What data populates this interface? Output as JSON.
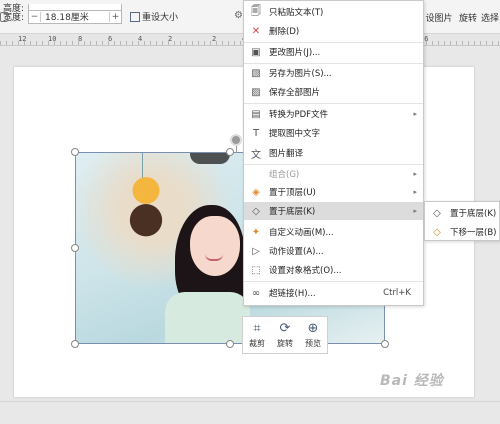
{
  "ribbon": {
    "height_label": "高度:",
    "width_label": "宽度:",
    "width_value": "18.18厘米",
    "minus": "−",
    "plus": "+",
    "reset_size": "重设大小",
    "set_picture": "设图片",
    "rotate": "旋转",
    "select": "选择"
  },
  "ruler": {
    "numbers": [
      "12",
      "10",
      "8",
      "6",
      "4",
      "2",
      "2",
      "4",
      "6",
      "8",
      "10",
      "12",
      "14",
      "16"
    ]
  },
  "context_menu": {
    "items": [
      {
        "icon": "paste-text-icon",
        "glyph": "🗐",
        "label": "只粘贴文本(T)"
      },
      {
        "icon": "delete-icon",
        "glyph": "✕",
        "label": "删除(D)"
      },
      {
        "icon": "change-picture-icon",
        "glyph": "▣",
        "label": "更改图片(J)..."
      },
      {
        "icon": "save-as-picture-icon",
        "glyph": "▧",
        "label": "另存为图片(S)..."
      },
      {
        "icon": "save-all-pictures-icon",
        "glyph": "▨",
        "label": "保存全部图片"
      },
      {
        "icon": "pdf-icon",
        "glyph": "▤",
        "label": "转换为PDF文件",
        "arrow": "▸"
      },
      {
        "icon": "extract-text-icon",
        "glyph": "T",
        "label": "提取图中文字"
      },
      {
        "icon": "translate-icon",
        "glyph": "文",
        "label": "图片翻译"
      },
      {
        "icon": "group-icon",
        "glyph": "",
        "label": "组合(G)",
        "arrow": "▸"
      },
      {
        "icon": "bring-to-front-icon",
        "glyph": "◈",
        "label": "置于顶层(U)",
        "arrow": "▸"
      },
      {
        "icon": "send-to-back-icon",
        "glyph": "◇",
        "label": "置于底层(K)",
        "arrow": "▸"
      },
      {
        "icon": "custom-animation-icon",
        "glyph": "✦",
        "label": "自定义动画(M)..."
      },
      {
        "icon": "action-settings-icon",
        "glyph": "▷",
        "label": "动作设置(A)..."
      },
      {
        "icon": "format-object-icon",
        "glyph": "⬚",
        "label": "设置对象格式(O)..."
      },
      {
        "icon": "hyperlink-icon",
        "glyph": "∞",
        "label": "超链接(H)...",
        "shortcut": "Ctrl+K"
      }
    ]
  },
  "submenu": {
    "items": [
      {
        "icon": "send-to-back-icon",
        "glyph": "◇",
        "label": "置于底层(K)"
      },
      {
        "icon": "send-backward-icon",
        "glyph": "◇",
        "label": "下移一层(B)"
      }
    ]
  },
  "float_toolbar": {
    "crop": "裁剪",
    "rotate": "旋转",
    "preview": "预览"
  },
  "watermark": "Bai 经验",
  "colors": {
    "accent": "#4a5a78",
    "highlight": "#dcdcdc"
  }
}
